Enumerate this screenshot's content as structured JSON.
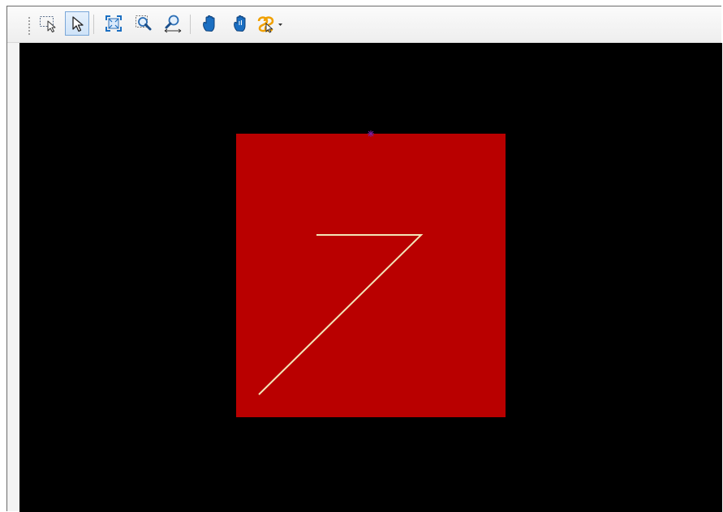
{
  "toolbar": {
    "tools": [
      {
        "icon": "select-region-icon",
        "active": false
      },
      {
        "icon": "select-arrow-icon",
        "active": true
      },
      {
        "icon": "zoom-extents-icon",
        "active": false
      },
      {
        "icon": "zoom-window-icon",
        "active": false
      },
      {
        "icon": "zoom-realtime-icon",
        "active": false
      },
      {
        "icon": "pan-icon",
        "active": false
      },
      {
        "icon": "pan-realtime-icon",
        "active": false
      },
      {
        "icon": "snap-dropdown-icon",
        "active": false
      }
    ]
  },
  "colors": {
    "canvas_bg": "#000000",
    "shape_fill": "#b90000",
    "stroke": "#f2e6b8",
    "marker": "#7a1fa2",
    "icon_blue": "#1b6fc2",
    "icon_orange": "#f0a000"
  }
}
